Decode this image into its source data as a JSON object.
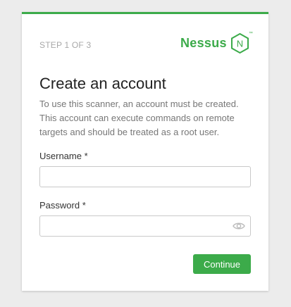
{
  "wizard": {
    "step_text": "STEP 1 OF 3",
    "logo_text": "Nessus",
    "logo_mark": "N",
    "logo_tm": "™"
  },
  "form": {
    "title": "Create an account",
    "description": "To use this scanner, an account must be created. This account can execute commands on remote targets and should be treated as a root user.",
    "username_label": "Username *",
    "username_value": "",
    "password_label": "Password *",
    "password_value": "",
    "show_password_icon": "eye-icon",
    "continue_label": "Continue"
  },
  "colors": {
    "accent": "#3cab4a",
    "background": "#ececec"
  }
}
